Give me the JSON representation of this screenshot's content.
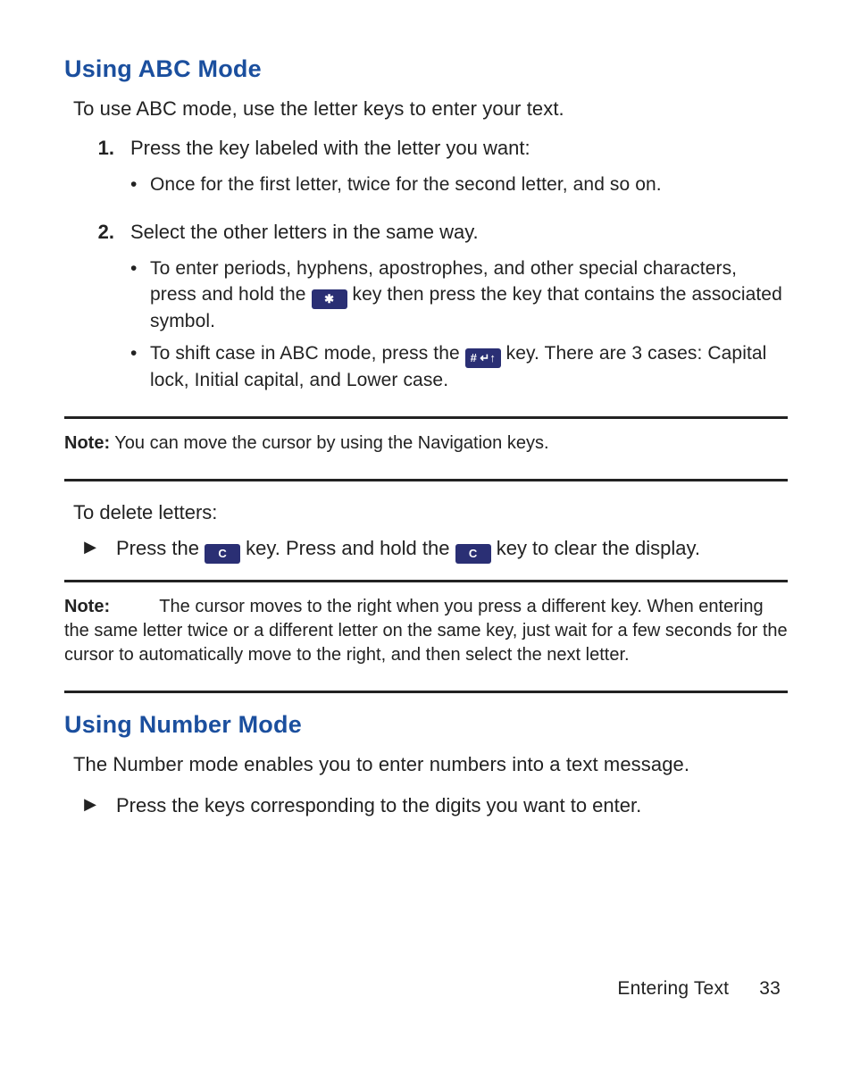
{
  "s1": {
    "title": "Using ABC Mode",
    "intro": "To use ABC mode, use the letter keys to enter your text.",
    "step1": {
      "num": "1.",
      "text": "Press the key labeled with the letter you want:",
      "b1": "Once for the first letter, twice for the second letter, and so on."
    },
    "step2": {
      "num": "2.",
      "text": "Select the other letters in the same way.",
      "b1a": "To enter periods, hyphens, apostrophes, and other special characters, press and hold the ",
      "b1b": " key then press the key that contains the associated symbol.",
      "b2a": "To shift case in ABC mode, press the ",
      "b2b": " key. There are 3 cases: Capital lock, Initial capital, and Lower case."
    }
  },
  "keys": {
    "star": "✱",
    "pound": "# ↵↑",
    "c": "C"
  },
  "note1": {
    "label": "Note:",
    "body": " You can move the cursor by using the Navigation keys."
  },
  "delete": {
    "intro": "To delete letters:",
    "a1": "Press the ",
    "a2": " key. Press and hold the ",
    "a3": " key to clear the display."
  },
  "note2": {
    "label": "Note:",
    "body": " The cursor moves to the right when you press a different key. When entering the same letter twice or a different letter on the same key, just wait for a few seconds for the cursor to automatically move to the right, and then select the next letter."
  },
  "s2": {
    "title": "Using Number Mode",
    "intro": "The Number mode enables you to enter numbers into a text message.",
    "arrow1": "Press the keys corresponding to the digits you want to enter."
  },
  "footer": {
    "section": "Entering Text",
    "page": "33"
  }
}
